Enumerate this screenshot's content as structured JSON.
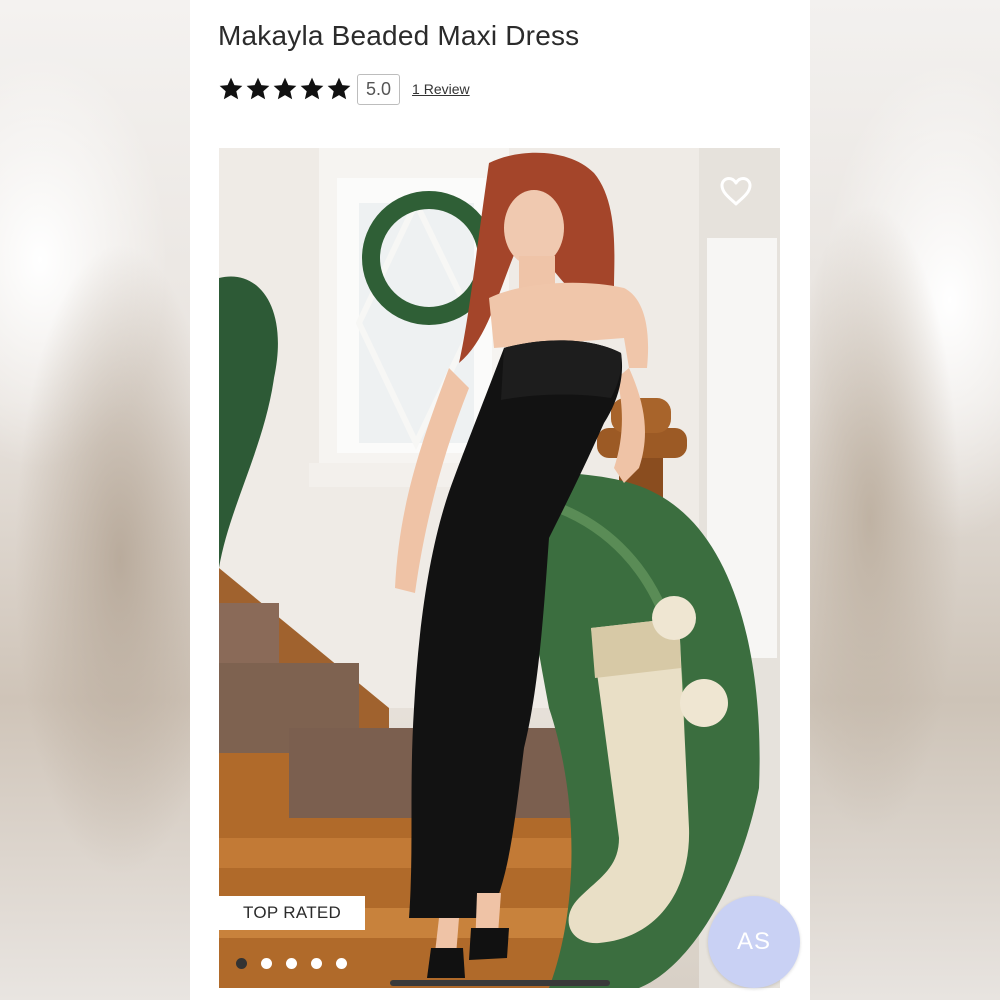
{
  "product": {
    "title": "Makayla Beaded Maxi Dress",
    "rating_value": "5.0",
    "stars_filled": 5,
    "stars_total": 5,
    "review_link": "1 Review"
  },
  "image": {
    "badge": "TOP RATED",
    "slide_count": 5,
    "active_slide": 1
  },
  "user": {
    "initials": "AS"
  },
  "colors": {
    "star": "#111111",
    "badge_bg": "#ffffff",
    "avatar_bg": "#c9d1f4",
    "dot_active": "#333333",
    "dot_inactive": "#ffffff"
  }
}
